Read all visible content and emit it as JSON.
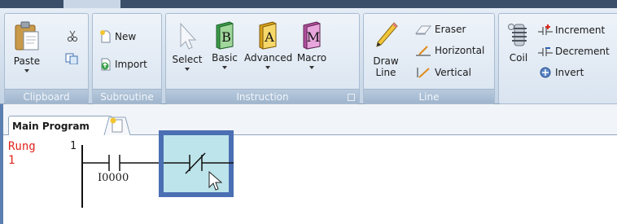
{
  "ribbon": {
    "groups": {
      "clipboard": "Clipboard",
      "subroutine": "Subroutine",
      "instruction": "Instruction",
      "line": "Line"
    },
    "paste": "Paste",
    "new": "New",
    "import": "Import",
    "select": "Select",
    "basic": "Basic",
    "advanced": "Advanced",
    "macro": "Macro",
    "basic_letter": "B",
    "advanced_letter": "A",
    "macro_letter": "M",
    "draw_line_1": "Draw",
    "draw_line_2": "Line",
    "eraser": "Eraser",
    "horizontal": "Horizontal",
    "vertical": "Vertical",
    "coil": "Coil",
    "increment": "Increment",
    "decrement": "Decrement",
    "invert": "Invert"
  },
  "tabs": {
    "main_program": "Main Program"
  },
  "rung": {
    "label_line1": "Rung",
    "label_line2": "1",
    "number": "1",
    "contact_address": "I0000"
  },
  "colors": {
    "rung_label": "#e0261d",
    "selection_border": "#4a6fb3",
    "selection_fill": "#bde4ea"
  }
}
